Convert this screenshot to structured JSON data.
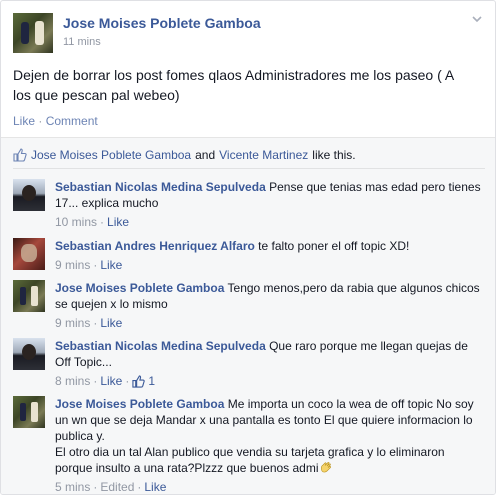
{
  "post": {
    "author": "Jose Moises Poblete Gamboa",
    "time": "11 mins",
    "text": "Dejen de borrar los post fomes qlaos Administradores me los paseo ( A los que pescan pal webeo)",
    "actions": {
      "like": "Like",
      "separator": "·",
      "comment": "Comment"
    }
  },
  "likes": {
    "user1": "Jose Moises Poblete Gamboa",
    "and": "and",
    "user2": "Vicente Martinez",
    "suffix": "like this."
  },
  "comments": [
    {
      "author": "Sebastian Nicolas Medina Sepulveda",
      "text": "Pense que tenias mas edad pero tienes 17... explica mucho",
      "time": "10 mins",
      "sep": "·",
      "like": "Like"
    },
    {
      "author": "Sebastian Andres Henriquez Alfaro",
      "text": "te falto poner el off topic XD!",
      "time": "9 mins",
      "sep": "·",
      "like": "Like"
    },
    {
      "author": "Jose Moises Poblete Gamboa",
      "text": "Tengo menos,pero da rabia que algunos chicos se quejen x lo mismo",
      "time": "9 mins",
      "sep": "·",
      "like": "Like"
    },
    {
      "author": "Sebastian Nicolas Medina Sepulveda",
      "text": "Que raro porque me llegan quejas de Off Topic...",
      "time": "8 mins",
      "sep": "·",
      "like": "Like",
      "sep2": "·",
      "like_count": "1"
    },
    {
      "author": "Jose Moises Poblete Gamboa",
      "text": "Me importa un coco la wea de off topic No soy un wn que se deja Mandar x una pantalla es tonto El que quiere informacion lo publica y.",
      "text2": "El otro dia un tal Alan publico que vendia su tarjeta grafica y lo eliminaron porque insulto a una rata?Plzzz que buenos admi",
      "time": "5 mins",
      "sep": "·",
      "edited": "Edited",
      "sep2": "·",
      "like": "Like"
    }
  ],
  "icons": [
    "chevron-down-icon",
    "thumbs-up-icon",
    "wave-hand-icon"
  ],
  "colors": {
    "link": "#3b5998",
    "meta": "#9197a3",
    "ufi_bg": "#f6f7f8"
  }
}
